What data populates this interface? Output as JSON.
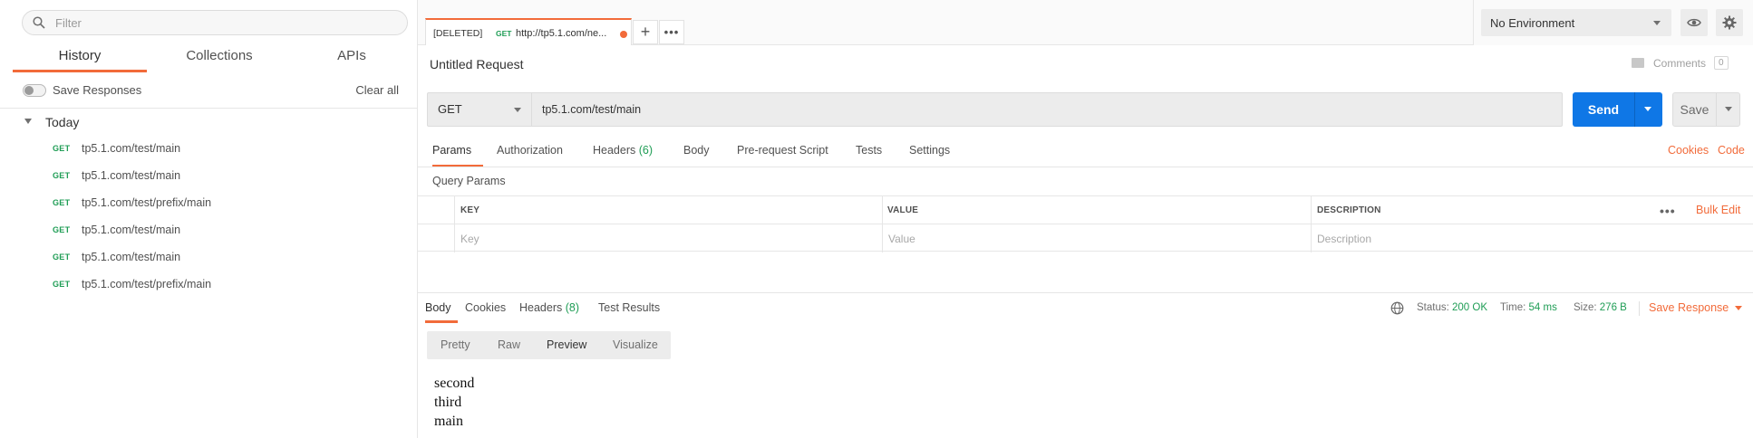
{
  "sidebar": {
    "search_placeholder": "Filter",
    "tabs": [
      {
        "label": "History",
        "active": true
      },
      {
        "label": "Collections",
        "active": false
      },
      {
        "label": "APIs",
        "active": false
      }
    ],
    "save_responses_label": "Save Responses",
    "clear_all_label": "Clear all",
    "group_label": "Today",
    "history": [
      {
        "method": "GET",
        "url": "tp5.1.com/test/main"
      },
      {
        "method": "GET",
        "url": "tp5.1.com/test/main"
      },
      {
        "method": "GET",
        "url": "tp5.1.com/test/prefix/main"
      },
      {
        "method": "GET",
        "url": "tp5.1.com/test/main"
      },
      {
        "method": "GET",
        "url": "tp5.1.com/test/main"
      },
      {
        "method": "GET",
        "url": "tp5.1.com/test/prefix/main"
      }
    ]
  },
  "tabbar": {
    "tab": {
      "prefix": "[DELETED]",
      "method": "GET",
      "url": "http://tp5.1.com/ne..."
    },
    "environment": "No Environment"
  },
  "request": {
    "name": "Untitled Request",
    "comments_label": "Comments",
    "comments_count": "0",
    "method": "GET",
    "url": "tp5.1.com/test/main",
    "send_label": "Send",
    "save_label": "Save",
    "tabs": {
      "params": "Params",
      "authorization": "Authorization",
      "headers": "Headers",
      "headers_count": "(6)",
      "body": "Body",
      "prerequest": "Pre-request Script",
      "tests": "Tests",
      "settings": "Settings"
    },
    "cookies_link": "Cookies",
    "code_link": "Code",
    "query_params_title": "Query Params",
    "table": {
      "headers": {
        "key": "KEY",
        "value": "VALUE",
        "description": "DESCRIPTION"
      },
      "placeholders": {
        "key": "Key",
        "value": "Value",
        "description": "Description"
      },
      "more": "•••",
      "bulk_edit": "Bulk Edit"
    }
  },
  "response": {
    "tabs": {
      "body": "Body",
      "cookies": "Cookies",
      "headers": "Headers",
      "headers_count": "(8)",
      "test_results": "Test Results"
    },
    "status_label": "Status:",
    "status_value": "200 OK",
    "time_label": "Time:",
    "time_value": "54 ms",
    "size_label": "Size:",
    "size_value": "276 B",
    "save_response_label": "Save Response",
    "formats": [
      "Pretty",
      "Raw",
      "Preview",
      "Visualize"
    ],
    "active_format": "Preview",
    "body_lines": [
      "second",
      "third",
      "main"
    ]
  },
  "colors": {
    "accent": "#f26b3a",
    "send": "#0f77e6",
    "get_method": "#1f9d55",
    "status_ok": "#1f9d55"
  }
}
